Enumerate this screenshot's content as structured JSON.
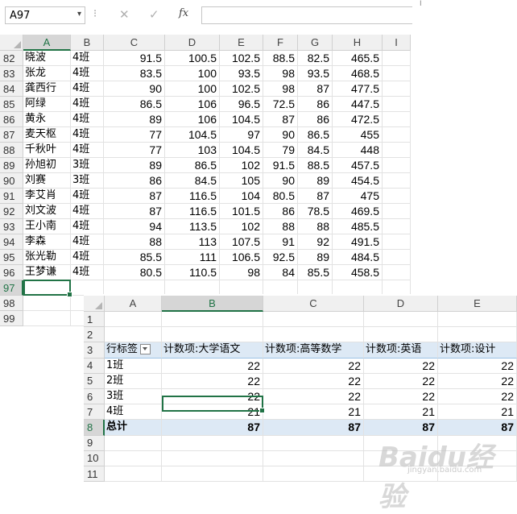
{
  "formula_bar": {
    "name_box": "A97",
    "name_box_arrow": "▾",
    "separator": "⁝",
    "cancel_icon": "✕",
    "enter_icon": "✓",
    "fx_label": "fx",
    "formula": ""
  },
  "sheet": {
    "columns": [
      "A",
      "B",
      "C",
      "D",
      "E",
      "F",
      "G",
      "H",
      "I"
    ],
    "rows": [
      {
        "n": "82",
        "name": "晓波",
        "cls": "4班",
        "c": "91.5",
        "d": "100.5",
        "e": "102.5",
        "f": "88.5",
        "g": "82.5",
        "h": "465.5"
      },
      {
        "n": "83",
        "name": "张龙",
        "cls": "4班",
        "c": "83.5",
        "d": "100",
        "e": "93.5",
        "f": "98",
        "g": "93.5",
        "h": "468.5"
      },
      {
        "n": "84",
        "name": "龚西行",
        "cls": "4班",
        "c": "90",
        "d": "100",
        "e": "102.5",
        "f": "98",
        "g": "87",
        "h": "477.5"
      },
      {
        "n": "85",
        "name": "阿绿",
        "cls": "4班",
        "c": "86.5",
        "d": "106",
        "e": "96.5",
        "f": "72.5",
        "g": "86",
        "h": "447.5"
      },
      {
        "n": "86",
        "name": "黄永",
        "cls": "4班",
        "c": "89",
        "d": "106",
        "e": "104.5",
        "f": "87",
        "g": "86",
        "h": "472.5"
      },
      {
        "n": "87",
        "name": "麦天枢",
        "cls": "4班",
        "c": "77",
        "d": "104.5",
        "e": "97",
        "f": "90",
        "g": "86.5",
        "h": "455"
      },
      {
        "n": "88",
        "name": "千秋叶",
        "cls": "4班",
        "c": "77",
        "d": "103",
        "e": "104.5",
        "f": "79",
        "g": "84.5",
        "h": "448"
      },
      {
        "n": "89",
        "name": "孙旭初",
        "cls": "3班",
        "c": "89",
        "d": "86.5",
        "e": "102",
        "f": "91.5",
        "g": "88.5",
        "h": "457.5"
      },
      {
        "n": "90",
        "name": "刘赛",
        "cls": "3班",
        "c": "86",
        "d": "84.5",
        "e": "105",
        "f": "90",
        "g": "89",
        "h": "454.5"
      },
      {
        "n": "91",
        "name": "李艾肖",
        "cls": "4班",
        "c": "87",
        "d": "116.5",
        "e": "104",
        "f": "80.5",
        "g": "87",
        "h": "475"
      },
      {
        "n": "92",
        "name": "刘文波",
        "cls": "4班",
        "c": "87",
        "d": "116.5",
        "e": "101.5",
        "f": "86",
        "g": "78.5",
        "h": "469.5"
      },
      {
        "n": "93",
        "name": "王小南",
        "cls": "4班",
        "c": "94",
        "d": "113.5",
        "e": "102",
        "f": "88",
        "g": "88",
        "h": "485.5"
      },
      {
        "n": "94",
        "name": "李森",
        "cls": "4班",
        "c": "88",
        "d": "113",
        "e": "107.5",
        "f": "91",
        "g": "92",
        "h": "491.5"
      },
      {
        "n": "95",
        "name": "张光勒",
        "cls": "4班",
        "c": "85.5",
        "d": "111",
        "e": "106.5",
        "f": "92.5",
        "g": "89",
        "h": "484.5"
      },
      {
        "n": "96",
        "name": "王梦谦",
        "cls": "4班",
        "c": "80.5",
        "d": "110.5",
        "e": "98",
        "f": "84",
        "g": "85.5",
        "h": "458.5"
      }
    ],
    "empty_rows": [
      "97",
      "98",
      "99"
    ]
  },
  "pivot": {
    "columns": [
      "A",
      "B",
      "C",
      "D",
      "E"
    ],
    "rows": [
      {
        "n": "1",
        "a": "",
        "b": "",
        "c": "",
        "d": "",
        "e": ""
      },
      {
        "n": "2",
        "a": "",
        "b": "",
        "c": "",
        "d": "",
        "e": ""
      },
      {
        "n": "3",
        "a": "行标签",
        "b": "计数项:大学语文",
        "c": "计数项:高等数学",
        "d": "计数项:英语",
        "e": "计数项:设计"
      },
      {
        "n": "4",
        "a": "1班",
        "b": "22",
        "c": "22",
        "d": "22",
        "e": "22"
      },
      {
        "n": "5",
        "a": "2班",
        "b": "22",
        "c": "22",
        "d": "22",
        "e": "22"
      },
      {
        "n": "6",
        "a": "3班",
        "b": "22",
        "c": "22",
        "d": "22",
        "e": "22"
      },
      {
        "n": "7",
        "a": "4班",
        "b": "21",
        "c": "21",
        "d": "21",
        "e": "21"
      },
      {
        "n": "8",
        "a": "总计",
        "b": "87",
        "c": "87",
        "d": "87",
        "e": "87"
      },
      {
        "n": "9",
        "a": "",
        "b": "",
        "c": "",
        "d": "",
        "e": ""
      },
      {
        "n": "10",
        "a": "",
        "b": "",
        "c": "",
        "d": "",
        "e": ""
      },
      {
        "n": "11",
        "a": "",
        "b": "",
        "c": "",
        "d": "",
        "e": ""
      }
    ]
  },
  "watermark": {
    "text": "Baidu经验",
    "sub": "jingyan.baidu.com"
  },
  "colors": {
    "accent": "#217346",
    "pivot_header_bg": "#dde9f5"
  }
}
